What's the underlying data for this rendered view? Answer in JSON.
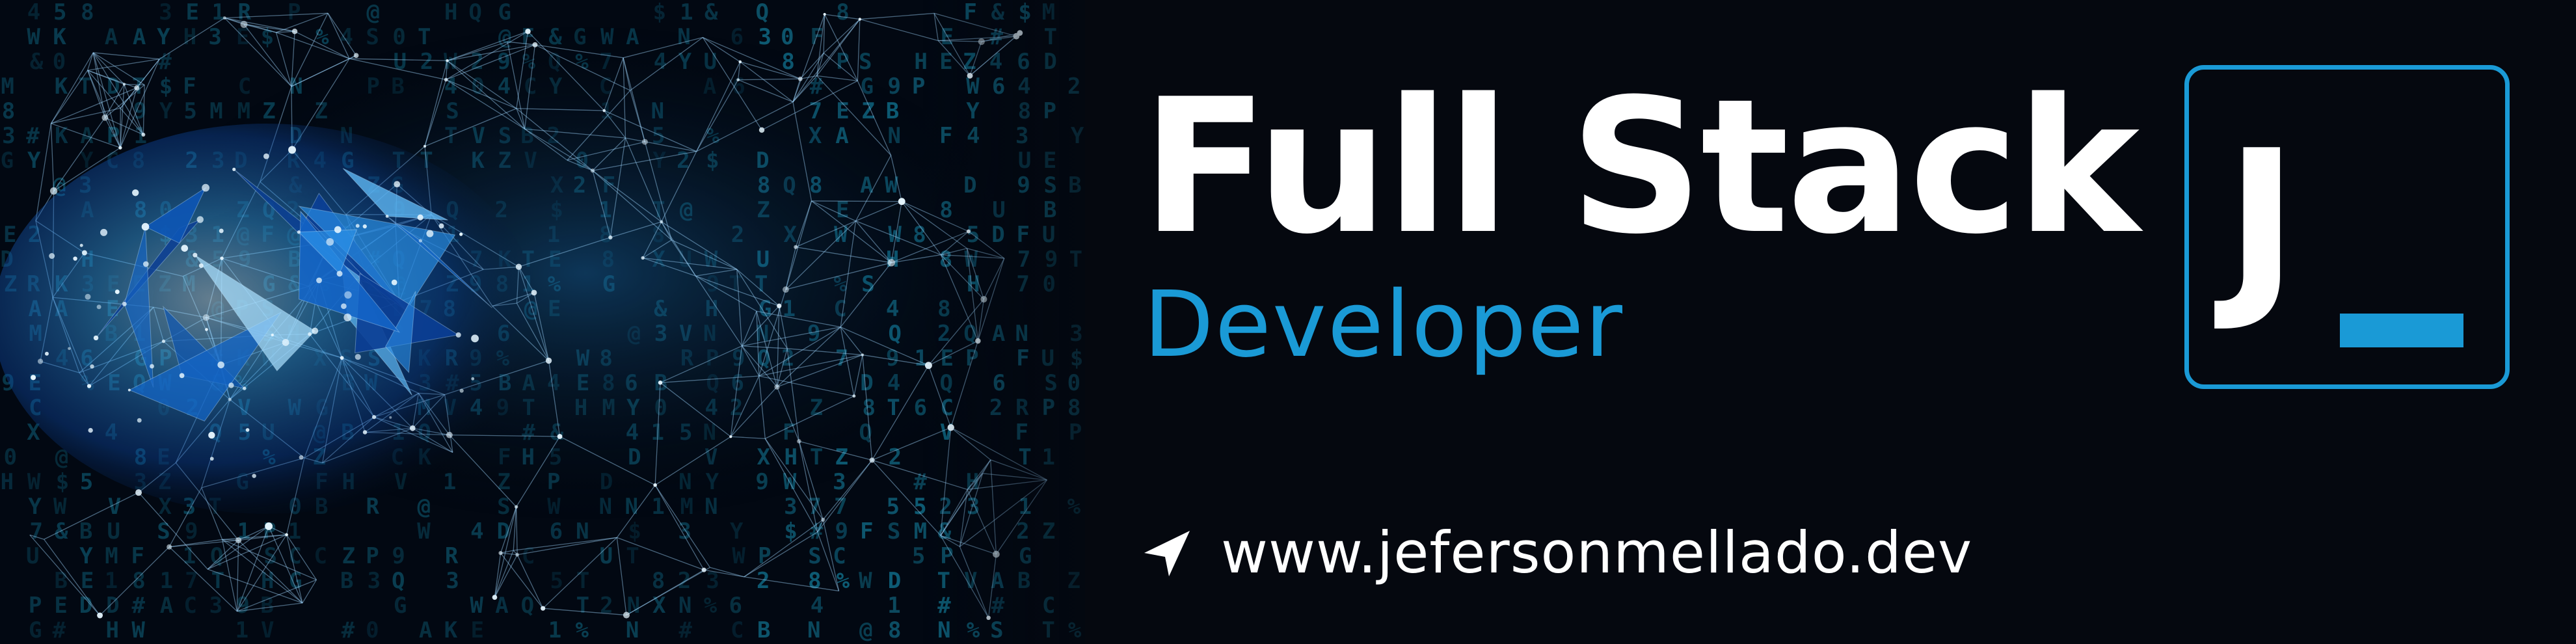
{
  "banner": {
    "title": "Full Stack",
    "subtitle": "Developer",
    "website": "www.jefersonmellado.dev",
    "logo_letter": "J",
    "website_icon": "navigation-arrow-icon",
    "art_description_icon": "network-brain-icon"
  },
  "colors": {
    "background": "#05080f",
    "accent": "#1a9ad6",
    "text": "#ffffff"
  }
}
